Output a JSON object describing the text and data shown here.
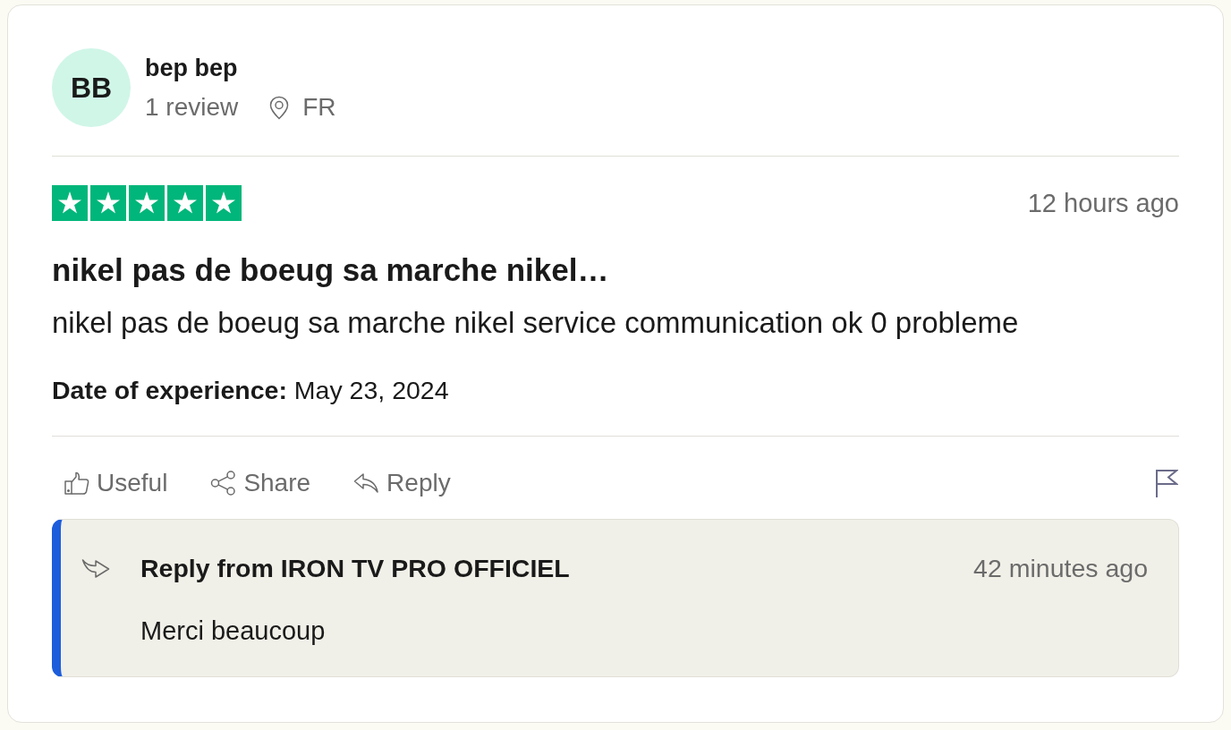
{
  "reviewer": {
    "initials": "BB",
    "name": "bep bep",
    "review_count": "1 review",
    "country": "FR"
  },
  "review": {
    "stars": 5,
    "time": "12 hours ago",
    "title": "nikel pas de boeug sa marche nikel…",
    "body": "nikel pas de boeug sa marche nikel service communication ok 0 probleme",
    "experience": "**Date of experience:** May 23, 2024"
  },
  "actions": [
    {
      "kind": "useful",
      "label": "Useful"
    },
    {
      "kind": "share",
      "label": "Share"
    },
    {
      "kind": "reply",
      "label": "Reply"
    }
  ],
  "company_reply": {
    "title": "Reply from IRON TV PRO OFFICIEL",
    "time": "42 minutes ago",
    "text": "Merci beaucoup"
  }
}
